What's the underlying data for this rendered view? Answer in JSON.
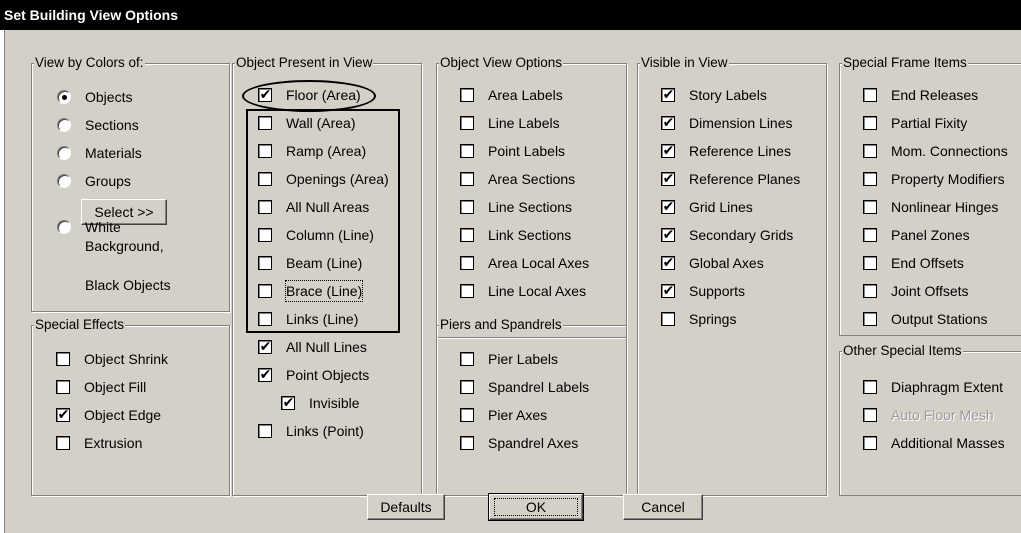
{
  "window": {
    "title": "Set Building View Options"
  },
  "view_by_colors": {
    "title": "View by Colors of:",
    "options": [
      {
        "label": "Objects",
        "selected": true
      },
      {
        "label": "Sections",
        "selected": false
      },
      {
        "label": "Materials",
        "selected": false
      },
      {
        "label": "Groups",
        "selected": false
      }
    ],
    "select_button": "Select >>",
    "white_option": {
      "lines": [
        "White",
        "Background,",
        "Black Objects"
      ],
      "selected": false
    }
  },
  "special_effects": {
    "title": "Special Effects",
    "items": [
      {
        "label": "Object Shrink",
        "checked": false
      },
      {
        "label": "Object Fill",
        "checked": false
      },
      {
        "label": "Object Edge",
        "checked": true
      },
      {
        "label": "Extrusion",
        "checked": false
      }
    ]
  },
  "object_present": {
    "title": "Object Present in View",
    "items": [
      {
        "label": "Floor (Area)",
        "checked": true
      },
      {
        "label": "Wall (Area)",
        "checked": false
      },
      {
        "label": "Ramp (Area)",
        "checked": false
      },
      {
        "label": "Openings (Area)",
        "checked": false
      },
      {
        "label": "All Null Areas",
        "checked": false
      },
      {
        "label": "Column (Line)",
        "checked": false
      },
      {
        "label": "Beam (Line)",
        "checked": false
      },
      {
        "label": "Brace (Line)",
        "checked": false
      },
      {
        "label": "Links (Line)",
        "checked": false
      },
      {
        "label": "All Null Lines",
        "checked": true
      },
      {
        "label": "Point Objects",
        "checked": true
      },
      {
        "label": "Invisible",
        "checked": true
      },
      {
        "label": "Links (Point)",
        "checked": false
      }
    ]
  },
  "object_view_options": {
    "title": "Object View Options",
    "items": [
      {
        "label": "Area Labels",
        "checked": false
      },
      {
        "label": "Line Labels",
        "checked": false
      },
      {
        "label": "Point Labels",
        "checked": false
      },
      {
        "label": "Area Sections",
        "checked": false
      },
      {
        "label": "Line Sections",
        "checked": false
      },
      {
        "label": "Link Sections",
        "checked": false
      },
      {
        "label": "Area Local Axes",
        "checked": false
      },
      {
        "label": "Line Local Axes",
        "checked": false
      }
    ]
  },
  "piers_spandrels": {
    "title": "Piers and Spandrels",
    "items": [
      {
        "label": "Pier Labels",
        "checked": false
      },
      {
        "label": "Spandrel Labels",
        "checked": false
      },
      {
        "label": "Pier Axes",
        "checked": false
      },
      {
        "label": "Spandrel Axes",
        "checked": false
      }
    ]
  },
  "visible_in_view": {
    "title": "Visible in View",
    "items": [
      {
        "label": "Story Labels",
        "checked": true
      },
      {
        "label": "Dimension Lines",
        "checked": true
      },
      {
        "label": "Reference Lines",
        "checked": true
      },
      {
        "label": "Reference Planes",
        "checked": true
      },
      {
        "label": "Grid Lines",
        "checked": true
      },
      {
        "label": "Secondary Grids",
        "checked": true
      },
      {
        "label": "Global Axes",
        "checked": true
      },
      {
        "label": "Supports",
        "checked": true
      },
      {
        "label": "Springs",
        "checked": false
      }
    ]
  },
  "special_frame_items": {
    "title": "Special Frame Items",
    "items": [
      {
        "label": "End Releases",
        "checked": false
      },
      {
        "label": "Partial Fixity",
        "checked": false
      },
      {
        "label": "Mom. Connections",
        "checked": false
      },
      {
        "label": "Property Modifiers",
        "checked": false
      },
      {
        "label": "Nonlinear Hinges",
        "checked": false
      },
      {
        "label": "Panel Zones",
        "checked": false
      },
      {
        "label": "End Offsets",
        "checked": false
      },
      {
        "label": "Joint Offsets",
        "checked": false
      },
      {
        "label": "Output Stations",
        "checked": false
      }
    ]
  },
  "other_special_items": {
    "title": "Other Special Items",
    "items": [
      {
        "label": "Diaphragm Extent",
        "checked": false,
        "disabled": false
      },
      {
        "label": "Auto Floor Mesh",
        "checked": false,
        "disabled": true
      },
      {
        "label": "Additional Masses",
        "checked": false,
        "disabled": false
      }
    ]
  },
  "buttons": {
    "defaults": "Defaults",
    "ok": "OK",
    "cancel": "Cancel"
  },
  "check_glyph": "✔"
}
